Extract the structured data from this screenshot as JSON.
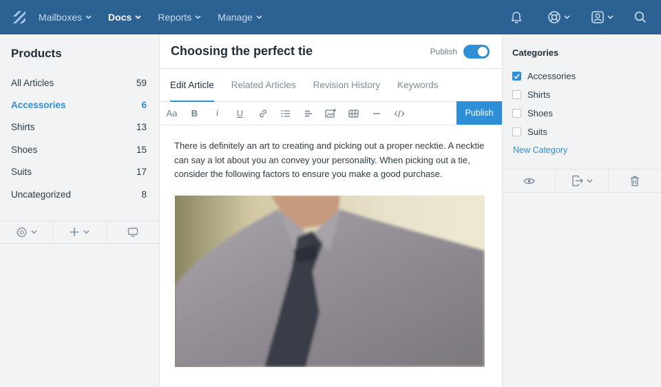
{
  "nav": {
    "items": [
      {
        "label": "Mailboxes",
        "active": false
      },
      {
        "label": "Docs",
        "active": true
      },
      {
        "label": "Reports",
        "active": false
      },
      {
        "label": "Manage",
        "active": false
      }
    ],
    "icons": [
      "logo-icon",
      "bell-icon",
      "help-lifebuoy-icon",
      "account-icon",
      "search-icon"
    ]
  },
  "left": {
    "title": "Products",
    "categories": [
      {
        "label": "All Articles",
        "count": "59"
      },
      {
        "label": "Accessories",
        "count": "6"
      },
      {
        "label": "Shirts",
        "count": "13"
      },
      {
        "label": "Shoes",
        "count": "15"
      },
      {
        "label": "Suits",
        "count": "17"
      },
      {
        "label": "Uncategorized",
        "count": "8"
      }
    ],
    "active_index": 1,
    "toolbar_icons": [
      "gear-icon",
      "plus-icon",
      "monitor-icon"
    ]
  },
  "article": {
    "title": "Choosing the perfect tie",
    "publish_label": "Publish",
    "publish_toggle_on": true,
    "tabs": [
      "Edit Article",
      "Related Articles",
      "Revision History",
      "Keywords"
    ],
    "active_tab": 0,
    "toolbar": {
      "format_label": "Aa",
      "bold_label": "B",
      "italic_label": "i",
      "underline_label": "U",
      "publish_button": "Publish"
    },
    "body": "There is definitely an art to creating and picking out a proper necktie. A necktie can say a lot about you an convey your personality. When picking out a tie, consider the following factors to ensure you make a good purchase."
  },
  "right": {
    "title": "Categories",
    "checkboxes": [
      {
        "label": "Accessories",
        "checked": true
      },
      {
        "label": "Shirts",
        "checked": false
      },
      {
        "label": "Shoes",
        "checked": false
      },
      {
        "label": "Suits",
        "checked": false
      }
    ],
    "new_category": "New Category",
    "toolbar_icons": [
      "eye-icon",
      "export-icon",
      "trash-icon"
    ]
  },
  "colors": {
    "nav_bg": "#2b6193",
    "accent": "#2e8fd6",
    "sidebar_bg": "#f1f3f5"
  }
}
